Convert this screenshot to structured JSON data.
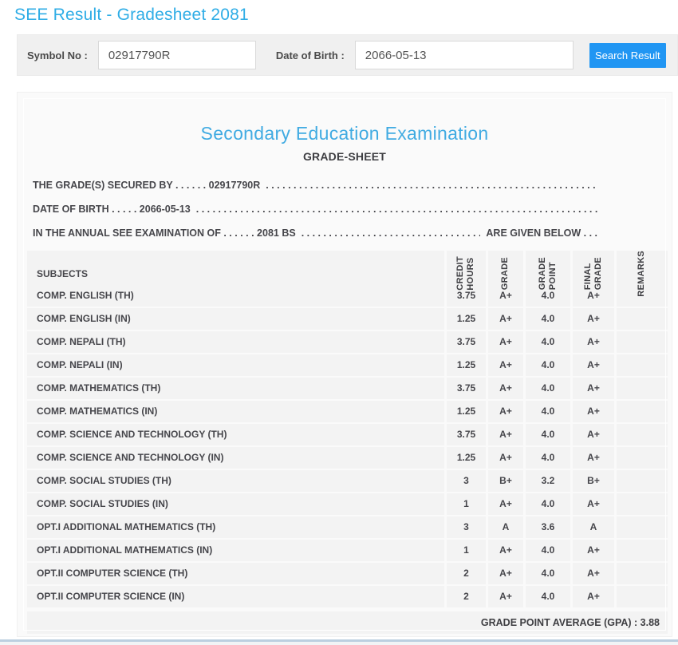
{
  "page": {
    "title": "SEE Result - Gradesheet 2081"
  },
  "colors": {
    "accent_blue": "#2fade6",
    "button_blue": "#2196f3"
  },
  "search": {
    "symbol_label": "Symbol No :",
    "symbol_value": "02917790R",
    "dob_label": "Date of Birth :",
    "dob_value": "2066-05-13",
    "button_label": "Search Result"
  },
  "gradesheet": {
    "heading": "Secondary Education Examination",
    "subheading": "GRADE-SHEET",
    "dot_filler": ". . . . . . . . . . . . . . . . . . . . . . . . . . . . . . . . . . . . . . . . . . . . . . . . . . . . . . . . . . . . . . . . . . . . . . . . . . . . . . . .",
    "lines": [
      {
        "prefix": "THE GRADE(S) SECURED BY . . . . . . 02917790R",
        "suffix": ""
      },
      {
        "prefix": "DATE OF BIRTH . . . . . 2066-05-13",
        "suffix": ""
      },
      {
        "prefix": "IN THE ANNUAL SEE EXAMINATION OF . . . . . . 2081 BS",
        "suffix": "ARE GIVEN BELOW . . ."
      }
    ],
    "table": {
      "subject_header": "SUBJECTS",
      "value_headers": [
        {
          "key": "credit-hours",
          "lines": [
            "CREDIT",
            "HOURS"
          ]
        },
        {
          "key": "grade",
          "lines": [
            "GRADE"
          ]
        },
        {
          "key": "grade-point",
          "lines": [
            "GRADE",
            "POINT"
          ]
        },
        {
          "key": "final-grade",
          "lines": [
            "FINAL",
            "GRADE"
          ]
        },
        {
          "key": "remarks",
          "lines": [
            "REMARKS"
          ]
        }
      ],
      "rows": [
        {
          "subject": "COMP. ENGLISH (TH)",
          "credit_hours": "3.75",
          "grade": "A+",
          "grade_point": "4.0",
          "final_grade": "A+",
          "remarks": ""
        },
        {
          "subject": "COMP. ENGLISH (IN)",
          "credit_hours": "1.25",
          "grade": "A+",
          "grade_point": "4.0",
          "final_grade": "A+",
          "remarks": ""
        },
        {
          "subject": "COMP. NEPALI (TH)",
          "credit_hours": "3.75",
          "grade": "A+",
          "grade_point": "4.0",
          "final_grade": "A+",
          "remarks": ""
        },
        {
          "subject": "COMP. NEPALI (IN)",
          "credit_hours": "1.25",
          "grade": "A+",
          "grade_point": "4.0",
          "final_grade": "A+",
          "remarks": ""
        },
        {
          "subject": "COMP. MATHEMATICS (TH)",
          "credit_hours": "3.75",
          "grade": "A+",
          "grade_point": "4.0",
          "final_grade": "A+",
          "remarks": ""
        },
        {
          "subject": "COMP. MATHEMATICS (IN)",
          "credit_hours": "1.25",
          "grade": "A+",
          "grade_point": "4.0",
          "final_grade": "A+",
          "remarks": ""
        },
        {
          "subject": "COMP. SCIENCE AND TECHNOLOGY (TH)",
          "credit_hours": "3.75",
          "grade": "A+",
          "grade_point": "4.0",
          "final_grade": "A+",
          "remarks": ""
        },
        {
          "subject": "COMP. SCIENCE AND TECHNOLOGY (IN)",
          "credit_hours": "1.25",
          "grade": "A+",
          "grade_point": "4.0",
          "final_grade": "A+",
          "remarks": ""
        },
        {
          "subject": "COMP. SOCIAL STUDIES (TH)",
          "credit_hours": "3",
          "grade": "B+",
          "grade_point": "3.2",
          "final_grade": "B+",
          "remarks": ""
        },
        {
          "subject": "COMP. SOCIAL STUDIES (IN)",
          "credit_hours": "1",
          "grade": "A+",
          "grade_point": "4.0",
          "final_grade": "A+",
          "remarks": ""
        },
        {
          "subject": "OPT.I ADDITIONAL MATHEMATICS (TH)",
          "credit_hours": "3",
          "grade": "A",
          "grade_point": "3.6",
          "final_grade": "A",
          "remarks": ""
        },
        {
          "subject": "OPT.I ADDITIONAL MATHEMATICS (IN)",
          "credit_hours": "1",
          "grade": "A+",
          "grade_point": "4.0",
          "final_grade": "A+",
          "remarks": ""
        },
        {
          "subject": "OPT.II COMPUTER SCIENCE (TH)",
          "credit_hours": "2",
          "grade": "A+",
          "grade_point": "4.0",
          "final_grade": "A+",
          "remarks": ""
        },
        {
          "subject": "OPT.II COMPUTER SCIENCE (IN)",
          "credit_hours": "2",
          "grade": "A+",
          "grade_point": "4.0",
          "final_grade": "A+",
          "remarks": ""
        }
      ],
      "gpa_footer": "GRADE POINT AVERAGE (GPA) : 3.88"
    }
  }
}
